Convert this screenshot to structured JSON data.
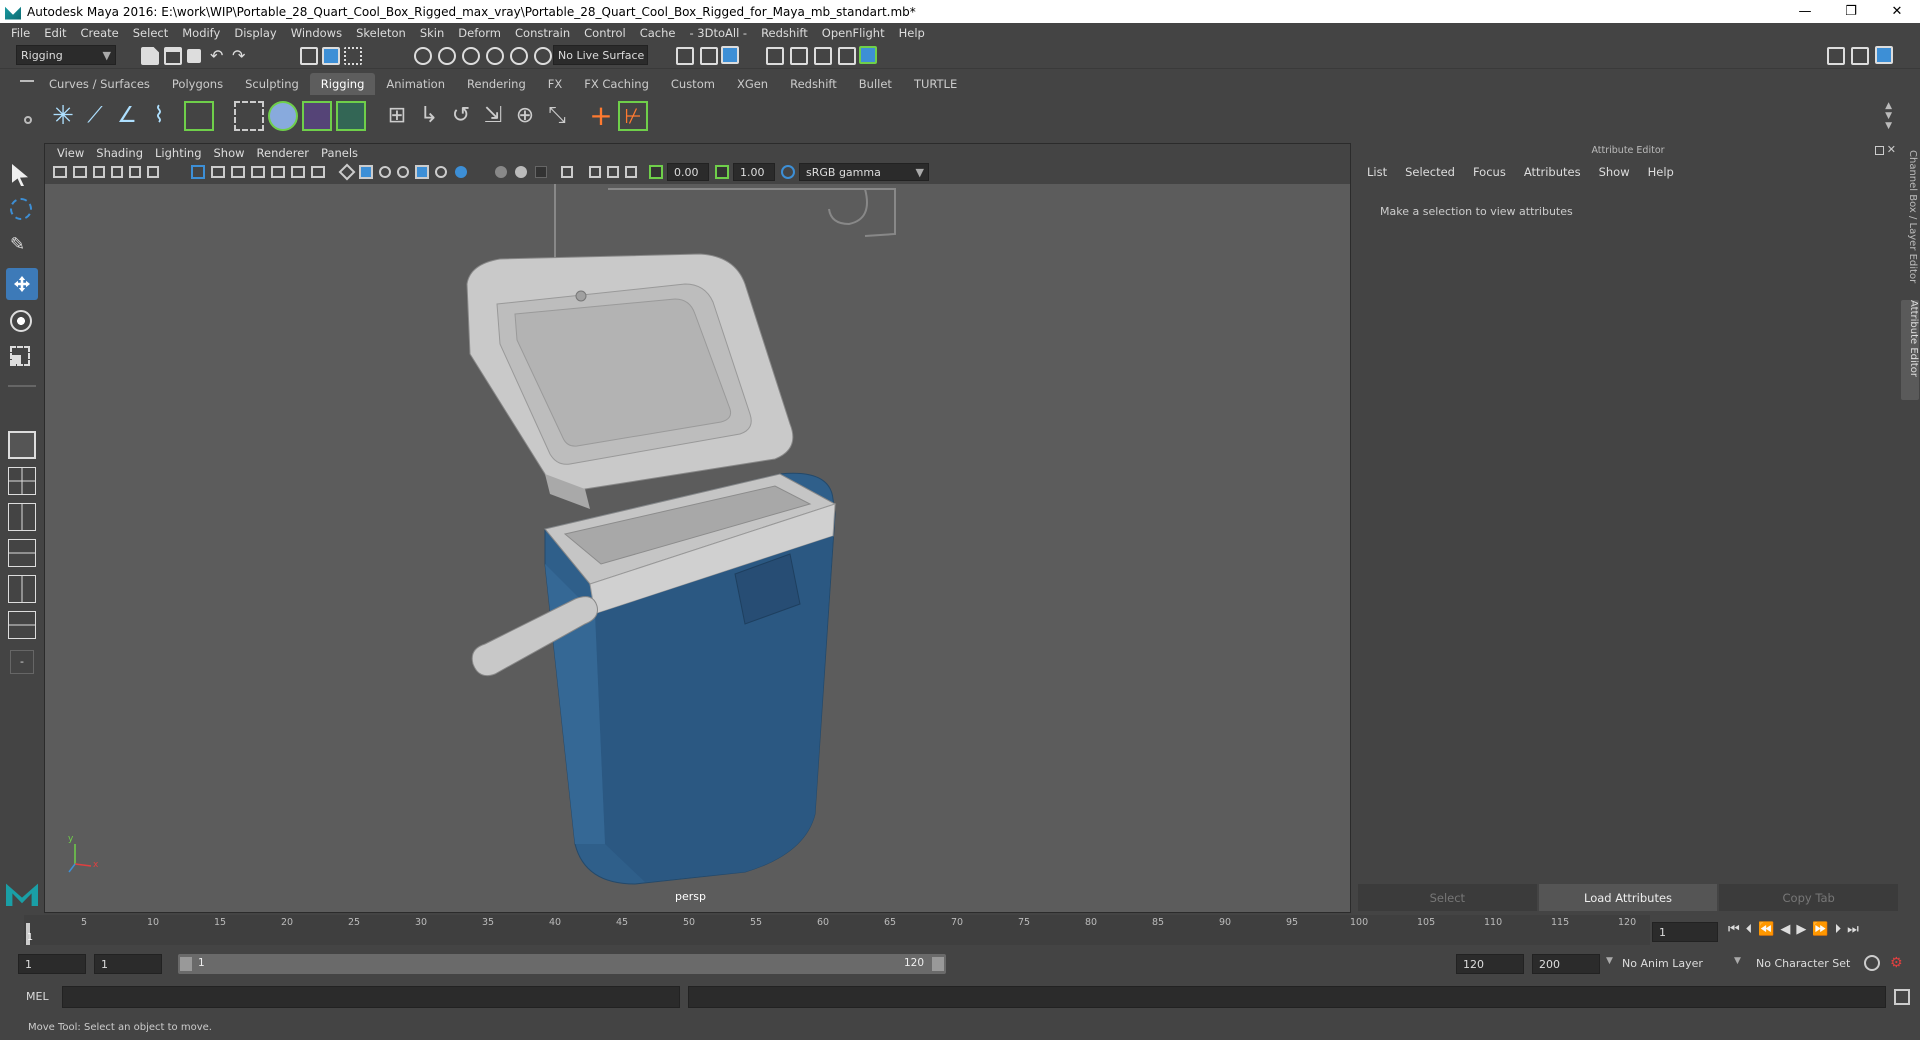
{
  "window": {
    "title": "Autodesk Maya 2016: E:\\work\\WIP\\Portable_28_Quart_Cool_Box_Rigged_max_vray\\Portable_28_Quart_Cool_Box_Rigged_for_Maya_mb_standart.mb*",
    "minimize": "—",
    "restore": "❐",
    "close": "✕"
  },
  "menubar": [
    "File",
    "Edit",
    "Create",
    "Select",
    "Modify",
    "Display",
    "Windows",
    "Skeleton",
    "Skin",
    "Deform",
    "Constrain",
    "Control",
    "Cache",
    "- 3DtoAll -",
    "Redshift",
    "OpenFlight",
    "Help"
  ],
  "statusline": {
    "menuset": "Rigging",
    "live_surface": "No Live Surface"
  },
  "shelf": {
    "tabs": [
      "Curves / Surfaces",
      "Polygons",
      "Sculpting",
      "Rigging",
      "Animation",
      "Rendering",
      "FX",
      "FX Caching",
      "Custom",
      "XGen",
      "Redshift",
      "Bullet",
      "TURTLE"
    ],
    "active_tab": "Rigging"
  },
  "viewport": {
    "menu": [
      "View",
      "Shading",
      "Lighting",
      "Show",
      "Renderer",
      "Panels"
    ],
    "exposure": "0.00",
    "gamma": "1.00",
    "color_space": "sRGB gamma",
    "camera": "persp",
    "axis_y": "y",
    "axis_x": "x"
  },
  "attribute_editor": {
    "title": "Attribute Editor",
    "menu": [
      "List",
      "Selected",
      "Focus",
      "Attributes",
      "Show",
      "Help"
    ],
    "message": "Make a selection to view attributes",
    "buttons": [
      "Select",
      "Load Attributes",
      "Copy Tab"
    ]
  },
  "side_tabs": {
    "channel_box": "Channel Box / Layer Editor",
    "attribute_editor": "Attribute Editor"
  },
  "timeline": {
    "ticks": [
      "1",
      "5",
      "10",
      "15",
      "20",
      "25",
      "30",
      "35",
      "40",
      "45",
      "50",
      "55",
      "60",
      "65",
      "70",
      "75",
      "80",
      "85",
      "90",
      "95",
      "100",
      "105",
      "110",
      "115",
      "120"
    ],
    "current_frame": "1"
  },
  "range": {
    "start": "1",
    "playback_start": "1",
    "slider_start": "1",
    "slider_end": "120",
    "playback_end": "120",
    "end": "200",
    "anim_layer": "No Anim Layer",
    "character_set": "No Character Set"
  },
  "cmdline": {
    "label": "MEL"
  },
  "helpline": {
    "text": "Move Tool: Select an object to move."
  },
  "colors": {
    "cooler_body": "#2f5f8a",
    "cooler_lid": "#c9c9c9",
    "viewport_bg": "#5c5c5c",
    "accent_green": "#6fcf4a",
    "accent_blue": "#3d8fd6"
  }
}
